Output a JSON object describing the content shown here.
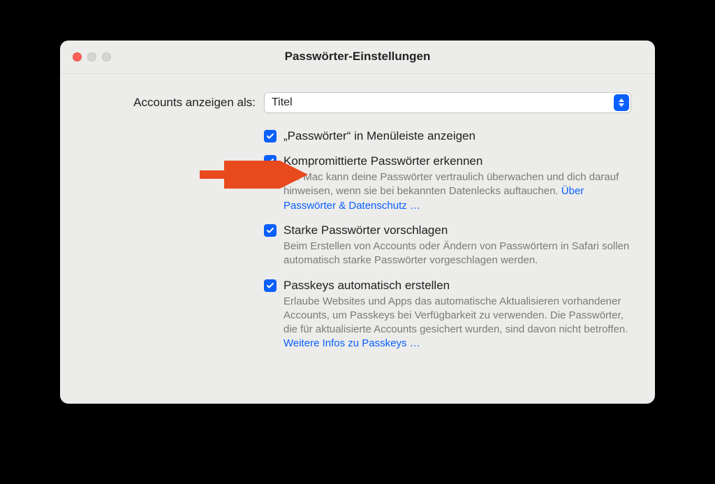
{
  "window": {
    "title": "Passwörter-Einstellungen"
  },
  "selectRow": {
    "label": "Accounts anzeigen als:",
    "value": "Titel"
  },
  "options": [
    {
      "checked": true,
      "label": "„Passwörter“ in Menüleiste anzeigen",
      "desc": "",
      "link": ""
    },
    {
      "checked": true,
      "label": "Kompromittierte Passwörter erkennen",
      "desc": "Der Mac kann deine Passwörter vertraulich überwachen und dich darauf hinweisen, wenn sie bei bekannten Datenlecks auftauchen. ",
      "link": "Über Passwörter & Datenschutz …"
    },
    {
      "checked": true,
      "label": "Starke Passwörter vorschlagen",
      "desc": "Beim Erstellen von Accounts oder Ändern von Pass­wörtern in Safari sollen automatisch starke Passwörter vorgeschlagen werden.",
      "link": ""
    },
    {
      "checked": true,
      "label": "Passkeys automatisch erstellen",
      "desc": "Erlaube Websites und Apps das automatische Aktualisieren vorhandener Accounts, um Passkeys bei Verfügbarkeit zu verwenden. Die Passwörter, die für aktualisierte Accounts gesichert wurden, sind davon nicht betroffen. ",
      "link": "Weitere Infos zu Passkeys …"
    }
  ],
  "colors": {
    "accent": "#0a60ff",
    "arrow": "#e8491d"
  }
}
